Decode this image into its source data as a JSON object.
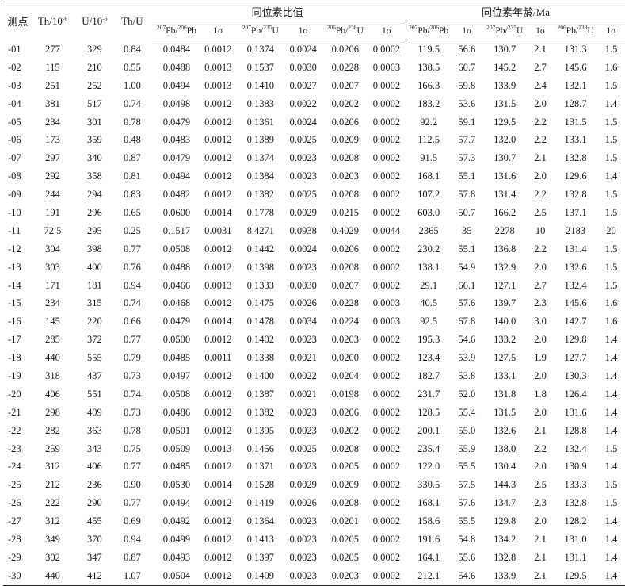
{
  "headers": {
    "spot": "测点",
    "th": "Th/10",
    "th_exp": "-6",
    "u": "U/10",
    "u_exp": "-6",
    "thu": "Th/U",
    "ratio_group": "同位素比值",
    "age_group": "同位素年龄/Ma",
    "r_pb207_pb206": {
      "a": "207",
      "b": "Pb/",
      "c": "206",
      "d": "Pb"
    },
    "r_pb207_u235": {
      "a": "207",
      "b": "Pb/",
      "c": "235",
      "d": "U"
    },
    "r_pb206_u238": {
      "a": "206",
      "b": "Pb/",
      "c": "238",
      "d": "U"
    },
    "sigma": "1σ"
  },
  "rows": [
    [
      "-01",
      "277",
      "329",
      "0.84",
      "0.0484",
      "0.0012",
      "0.1374",
      "0.0024",
      "0.0206",
      "0.0002",
      "119.5",
      "56.6",
      "130.7",
      "2.1",
      "131.3",
      "1.5"
    ],
    [
      "-02",
      "115",
      "210",
      "0.55",
      "0.0488",
      "0.0013",
      "0.1537",
      "0.0030",
      "0.0228",
      "0.0003",
      "138.5",
      "60.7",
      "145.2",
      "2.7",
      "145.6",
      "1.6"
    ],
    [
      "-03",
      "251",
      "252",
      "1.00",
      "0.0494",
      "0.0013",
      "0.1410",
      "0.0027",
      "0.0207",
      "0.0002",
      "166.3",
      "59.8",
      "133.9",
      "2.4",
      "132.1",
      "1.5"
    ],
    [
      "-04",
      "381",
      "517",
      "0.74",
      "0.0498",
      "0.0012",
      "0.1383",
      "0.0022",
      "0.0202",
      "0.0002",
      "183.2",
      "53.6",
      "131.5",
      "2.0",
      "128.7",
      "1.4"
    ],
    [
      "-05",
      "234",
      "301",
      "0.78",
      "0.0479",
      "0.0012",
      "0.1361",
      "0.0024",
      "0.0206",
      "0.0002",
      "92.2",
      "59.1",
      "129.5",
      "2.2",
      "131.5",
      "1.5"
    ],
    [
      "-06",
      "173",
      "359",
      "0.48",
      "0.0483",
      "0.0012",
      "0.1389",
      "0.0025",
      "0.0209",
      "0.0002",
      "112.5",
      "57.7",
      "132.0",
      "2.2",
      "133.1",
      "1.5"
    ],
    [
      "-07",
      "297",
      "340",
      "0.87",
      "0.0479",
      "0.0012",
      "0.1374",
      "0.0023",
      "0.0208",
      "0.0002",
      "91.5",
      "57.3",
      "130.7",
      "2.1",
      "132.8",
      "1.5"
    ],
    [
      "-08",
      "292",
      "358",
      "0.81",
      "0.0494",
      "0.0012",
      "0.1384",
      "0.0023",
      "0.0203",
      "0.0002",
      "168.1",
      "55.1",
      "131.6",
      "2.0",
      "129.6",
      "1.4"
    ],
    [
      "-09",
      "244",
      "294",
      "0.83",
      "0.0482",
      "0.0012",
      "0.1382",
      "0.0025",
      "0.0208",
      "0.0002",
      "107.2",
      "57.8",
      "131.4",
      "2.2",
      "132.8",
      "1.5"
    ],
    [
      "-10",
      "191",
      "296",
      "0.65",
      "0.0600",
      "0.0014",
      "0.1778",
      "0.0029",
      "0.0215",
      "0.0002",
      "603.0",
      "50.7",
      "166.2",
      "2.5",
      "137.1",
      "1.5"
    ],
    [
      "-11",
      "72.5",
      "295",
      "0.25",
      "0.1517",
      "0.0031",
      "8.4271",
      "0.0938",
      "0.4029",
      "0.0044",
      "2365",
      "35",
      "2278",
      "10",
      "2183",
      "20"
    ],
    [
      "-12",
      "304",
      "398",
      "0.77",
      "0.0508",
      "0.0012",
      "0.1442",
      "0.0024",
      "0.0206",
      "0.0002",
      "230.2",
      "55.1",
      "136.8",
      "2.2",
      "131.4",
      "1.5"
    ],
    [
      "-13",
      "303",
      "400",
      "0.76",
      "0.0488",
      "0.0012",
      "0.1398",
      "0.0023",
      "0.0208",
      "0.0002",
      "138.1",
      "54.9",
      "132.9",
      "2.0",
      "132.6",
      "1.5"
    ],
    [
      "-14",
      "171",
      "181",
      "0.94",
      "0.0466",
      "0.0013",
      "0.1333",
      "0.0030",
      "0.0207",
      "0.0002",
      "29.1",
      "66.1",
      "127.1",
      "2.7",
      "132.4",
      "1.5"
    ],
    [
      "-15",
      "234",
      "315",
      "0.74",
      "0.0468",
      "0.0012",
      "0.1475",
      "0.0026",
      "0.0228",
      "0.0003",
      "40.5",
      "57.6",
      "139.7",
      "2.3",
      "145.6",
      "1.6"
    ],
    [
      "-16",
      "145",
      "220",
      "0.66",
      "0.0479",
      "0.0014",
      "0.1478",
      "0.0034",
      "0.0224",
      "0.0003",
      "92.5",
      "67.8",
      "140.0",
      "3.0",
      "142.7",
      "1.6"
    ],
    [
      "-17",
      "285",
      "372",
      "0.77",
      "0.0500",
      "0.0012",
      "0.1402",
      "0.0023",
      "0.0203",
      "0.0002",
      "195.3",
      "54.6",
      "133.2",
      "2.0",
      "129.8",
      "1.4"
    ],
    [
      "-18",
      "440",
      "555",
      "0.79",
      "0.0485",
      "0.0011",
      "0.1338",
      "0.0021",
      "0.0200",
      "0.0002",
      "123.4",
      "53.9",
      "127.5",
      "1.9",
      "127.7",
      "1.4"
    ],
    [
      "-19",
      "318",
      "437",
      "0.73",
      "0.0497",
      "0.0012",
      "0.1400",
      "0.0022",
      "0.0204",
      "0.0002",
      "182.7",
      "53.8",
      "133.1",
      "2.0",
      "130.3",
      "1.4"
    ],
    [
      "-20",
      "406",
      "551",
      "0.74",
      "0.0508",
      "0.0012",
      "0.1387",
      "0.0021",
      "0.0198",
      "0.0002",
      "231.7",
      "52.0",
      "131.8",
      "1.8",
      "126.4",
      "1.4"
    ],
    [
      "-21",
      "298",
      "409",
      "0.73",
      "0.0486",
      "0.0012",
      "0.1382",
      "0.0023",
      "0.0206",
      "0.0002",
      "128.5",
      "55.4",
      "131.5",
      "2.0",
      "131.6",
      "1.4"
    ],
    [
      "-22",
      "282",
      "363",
      "0.78",
      "0.0501",
      "0.0012",
      "0.1395",
      "0.0023",
      "0.0202",
      "0.0002",
      "200.1",
      "55.0",
      "132.6",
      "2.1",
      "128.8",
      "1.4"
    ],
    [
      "-23",
      "259",
      "343",
      "0.75",
      "0.0509",
      "0.0013",
      "0.1456",
      "0.0025",
      "0.0208",
      "0.0002",
      "235.4",
      "55.9",
      "138.0",
      "2.2",
      "132.4",
      "1.5"
    ],
    [
      "-24",
      "312",
      "406",
      "0.77",
      "0.0485",
      "0.0012",
      "0.1371",
      "0.0023",
      "0.0205",
      "0.0002",
      "122.0",
      "55.5",
      "130.4",
      "2.0",
      "130.9",
      "1.4"
    ],
    [
      "-25",
      "212",
      "236",
      "0.90",
      "0.0530",
      "0.0014",
      "0.1528",
      "0.0029",
      "0.0209",
      "0.0002",
      "330.5",
      "57.5",
      "144.3",
      "2.5",
      "133.3",
      "1.5"
    ],
    [
      "-26",
      "222",
      "290",
      "0.77",
      "0.0494",
      "0.0012",
      "0.1419",
      "0.0026",
      "0.0208",
      "0.0002",
      "168.1",
      "57.6",
      "134.7",
      "2.3",
      "132.8",
      "1.5"
    ],
    [
      "-27",
      "312",
      "455",
      "0.69",
      "0.0492",
      "0.0012",
      "0.1364",
      "0.0023",
      "0.0201",
      "0.0002",
      "158.6",
      "55.5",
      "129.8",
      "2.0",
      "128.2",
      "1.4"
    ],
    [
      "-28",
      "349",
      "370",
      "0.94",
      "0.0499",
      "0.0012",
      "0.1413",
      "0.0023",
      "0.0205",
      "0.0002",
      "191.6",
      "54.8",
      "134.2",
      "2.1",
      "131.0",
      "1.4"
    ],
    [
      "-29",
      "302",
      "347",
      "0.87",
      "0.0493",
      "0.0012",
      "0.1397",
      "0.0023",
      "0.0205",
      "0.0002",
      "164.1",
      "55.6",
      "132.8",
      "2.1",
      "131.1",
      "1.4"
    ],
    [
      "-30",
      "440",
      "412",
      "1.07",
      "0.0504",
      "0.0012",
      "0.1409",
      "0.0023",
      "0.0203",
      "0.0002",
      "212.1",
      "54.6",
      "133.9",
      "2.1",
      "129.5",
      "1.4"
    ]
  ]
}
